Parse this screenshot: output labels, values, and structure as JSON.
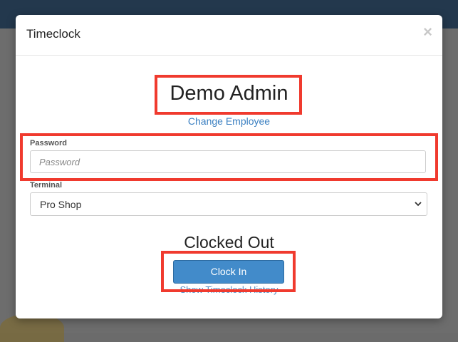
{
  "modal": {
    "title": "Timeclock",
    "close_label": "×"
  },
  "employee": {
    "name": "Demo Admin",
    "change_label": "Change Employee"
  },
  "password": {
    "label": "Password",
    "placeholder": "Password",
    "value": ""
  },
  "terminal": {
    "label": "Terminal",
    "selected": "Pro Shop"
  },
  "status": {
    "text": "Clocked Out"
  },
  "actions": {
    "clock_in_label": "Clock In",
    "history_label": "Show Timeclock History"
  },
  "colors": {
    "primary_button": "#428bca",
    "link": "#3a7fc1",
    "highlight": "#f03a2e",
    "topbar": "#23384d"
  }
}
